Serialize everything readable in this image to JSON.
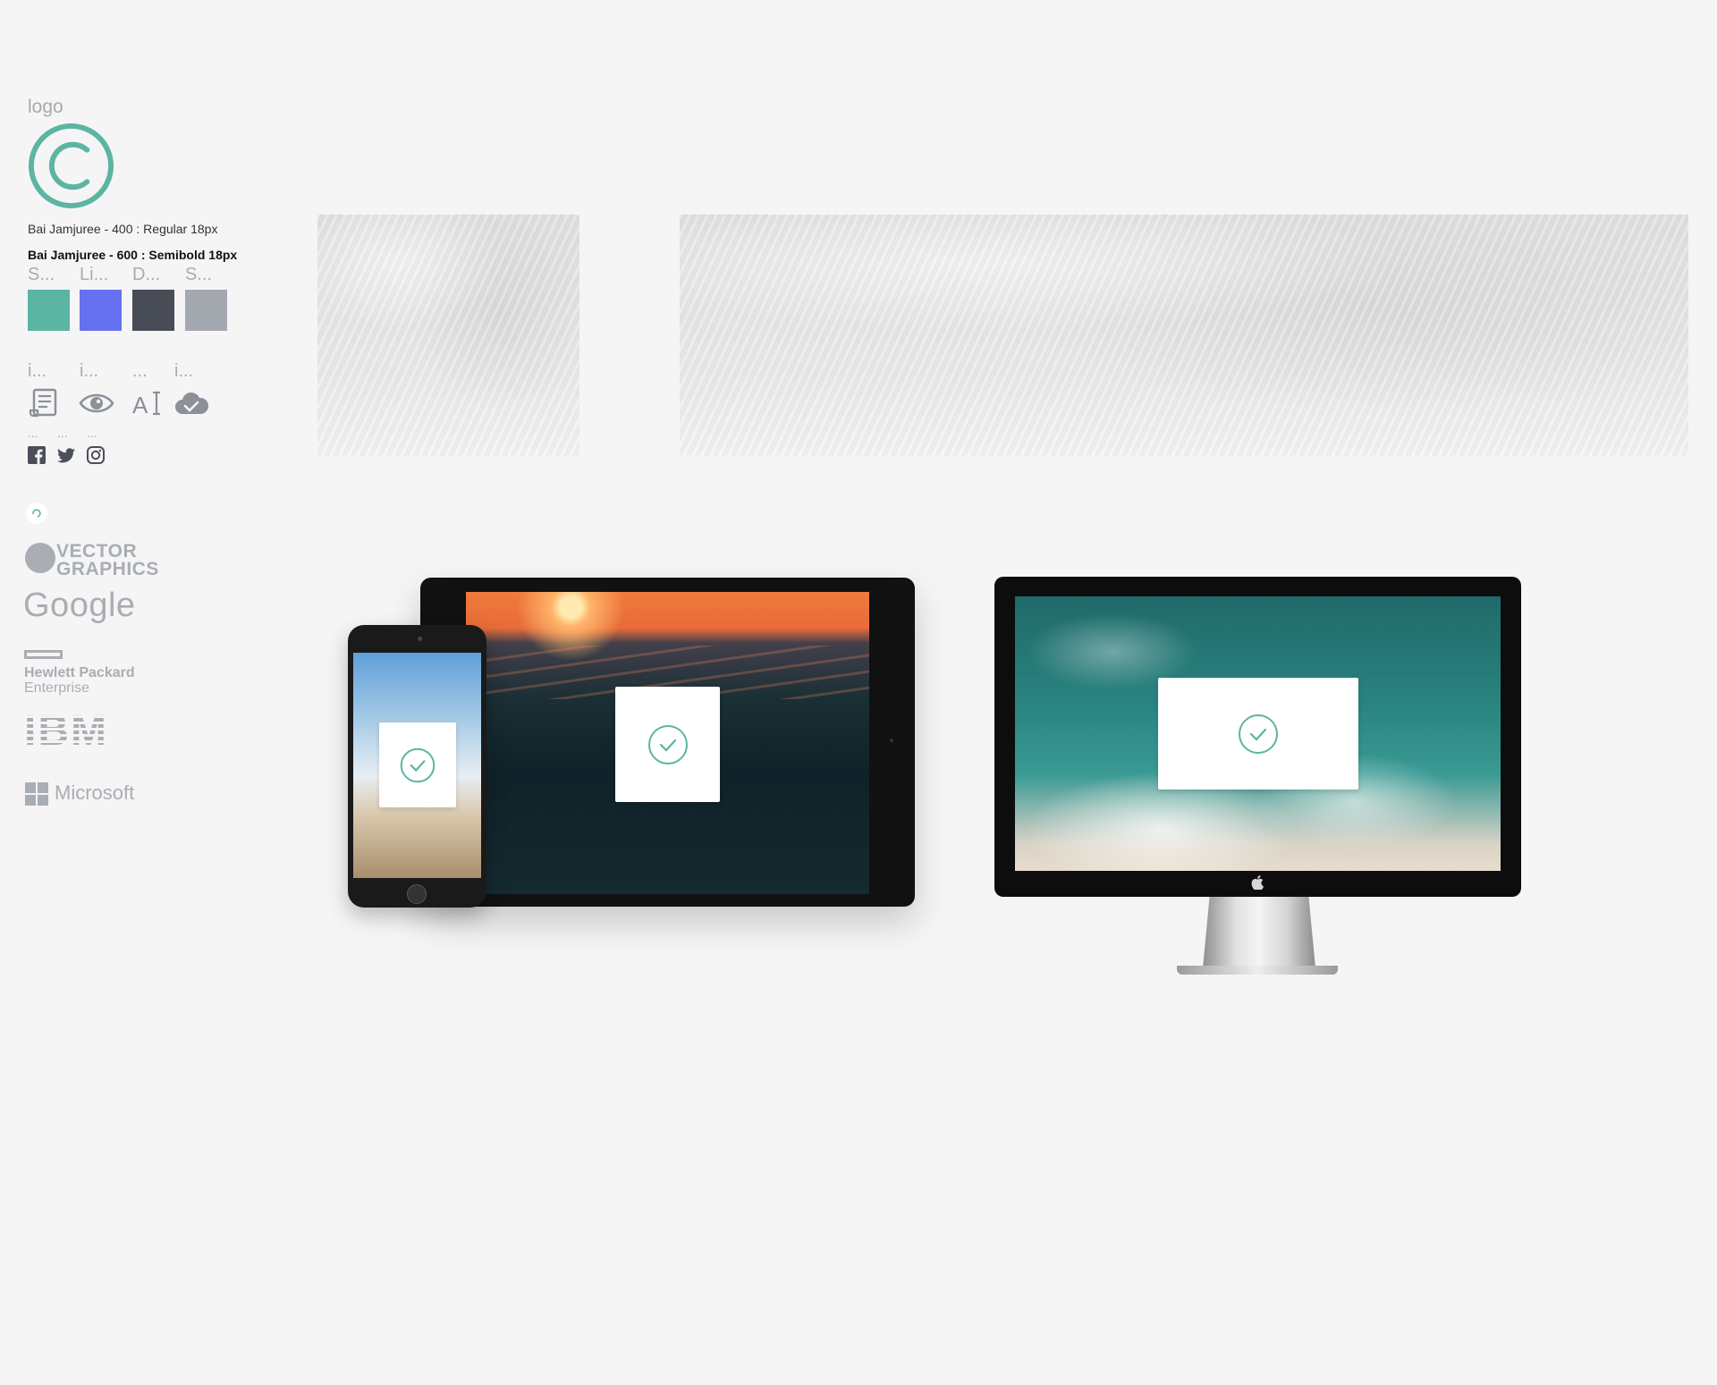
{
  "sidebar": {
    "logo_label": "logo",
    "font_regular": "Bai Jamjuree - 400 : Regular 18px",
    "font_semibold": "Bai Jamjuree - 600 : Semibold 18px",
    "swatches": [
      {
        "label": "S...",
        "color": "#5bb5a2"
      },
      {
        "label": "Li...",
        "color": "#6571f0"
      },
      {
        "label": "D...",
        "color": "#474c57"
      },
      {
        "label": "S...",
        "color": "#a4a9b0"
      }
    ],
    "icons": [
      {
        "label": "i...",
        "name": "document-icon"
      },
      {
        "label": "i...",
        "name": "eye-icon"
      },
      {
        "label": "...",
        "name": "text-cursor-icon"
      },
      {
        "label": "i...",
        "name": "cloud-check-icon"
      }
    ],
    "social": [
      {
        "label": "...",
        "name": "facebook-icon"
      },
      {
        "label": "...",
        "name": "twitter-icon"
      },
      {
        "label": "...",
        "name": "instagram-icon"
      }
    ],
    "brands": {
      "vector_line1": "VECTOR",
      "vector_line2": "GRAPHICS",
      "google": "Google",
      "hp_line1": "Hewlett Packard",
      "hp_line2": "Enterprise",
      "ibm": "IBM",
      "microsoft": "Microsoft"
    }
  },
  "colors": {
    "accent": "#5bb5a2",
    "background": "#f5f5f5"
  }
}
